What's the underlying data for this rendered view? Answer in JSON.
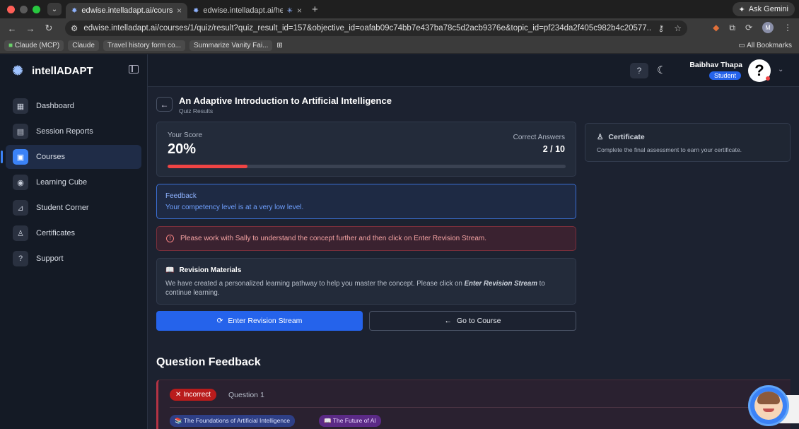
{
  "browser": {
    "tabs": [
      {
        "title": "edwise.intelladapt.ai/courses/"
      },
      {
        "title": "edwise.intelladapt.ai/hea"
      }
    ],
    "ask_gemini": "Ask Gemini",
    "url": "edwise.intelladapt.ai/courses/1/quiz/result?quiz_result_id=157&objective_id=oafab09c74bb7e437ba78c5d2acb9376e&topic_id=pf234da2f405c982b4c20577...",
    "profile_initial": "M",
    "bookmarks": [
      "Claude (MCP)",
      "Claude",
      "Travel history form co...",
      "Summarize Vanity Fai..."
    ],
    "all_bookmarks": "All Bookmarks"
  },
  "sidebar": {
    "brand": "intellADAPT",
    "items": [
      {
        "label": "Dashboard",
        "icon": "grid-icon"
      },
      {
        "label": "Session Reports",
        "icon": "report-icon"
      },
      {
        "label": "Courses",
        "icon": "book-icon",
        "active": true
      },
      {
        "label": "Learning Cube",
        "icon": "cube-icon"
      },
      {
        "label": "Student Corner",
        "icon": "chart-icon"
      },
      {
        "label": "Certificates",
        "icon": "award-icon"
      },
      {
        "label": "Support",
        "icon": "help-icon"
      }
    ]
  },
  "header": {
    "user_name": "Baibhav Thapa",
    "user_role": "Student",
    "avatar_glyph": "?"
  },
  "main": {
    "title": "An Adaptive Introduction to Artificial Intelligence",
    "subtitle": "Quiz Results",
    "score": {
      "label": "Your Score",
      "value": "20%",
      "progress_fraction": 0.2,
      "correct_label": "Correct Answers",
      "correct_value": "2 / 10"
    },
    "certificate": {
      "title": "Certificate",
      "text": "Complete the final assessment to earn your certificate."
    },
    "feedback": {
      "title": "Feedback",
      "text": "Your competency level is at a very low level."
    },
    "alert": "Please work with Sally to understand the concept further and then click on Enter Revision Stream.",
    "revision": {
      "title": "Revision Materials",
      "text_before": "We have created a personalized learning pathway to help you master the concept. Please click on ",
      "text_emphasis": "Enter Revision Stream",
      "text_after": " to continue learning."
    },
    "buttons": {
      "enter_revision": "Enter Revision Stream",
      "go_to_course": "Go to Course"
    },
    "question_feedback": {
      "heading": "Question Feedback",
      "status": "✕ Incorrect",
      "question_label": "Question 1",
      "tags": [
        "📚 The Foundations of Artificial Intelligence",
        "📖 The Future of AI"
      ]
    }
  },
  "colors": {
    "accent": "#3b82f6",
    "danger": "#ef4444",
    "background": "#1c2230"
  }
}
